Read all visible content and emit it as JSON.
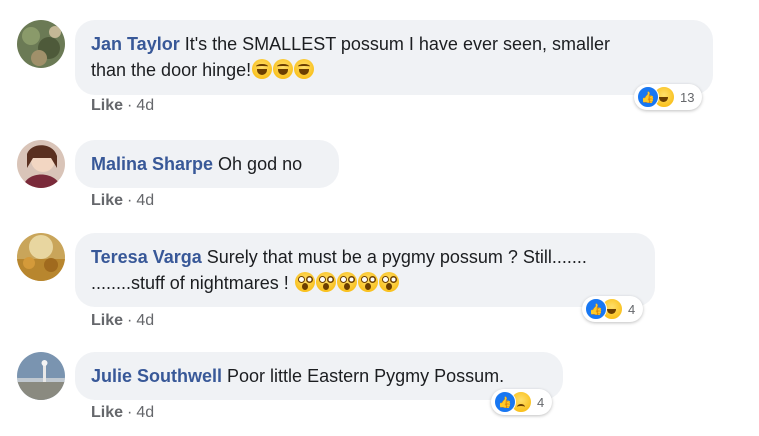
{
  "comments": [
    {
      "author": "Jan Taylor",
      "text": "It's the SMALLEST possum I have ever seen, smaller than the door hinge!",
      "text_line1": "It's the SMALLEST possum I have ever seen, smaller",
      "text_line2": "than the door hinge!",
      "like_label": "Like",
      "time": "4d",
      "reaction_count": "13",
      "reactions": [
        "like-icon",
        "haha-icon"
      ],
      "emojis": [
        "rolling-laughing-emoji",
        "rolling-laughing-emoji",
        "rolling-laughing-emoji"
      ]
    },
    {
      "author": "Malina Sharpe",
      "text": "Oh god no",
      "like_label": "Like",
      "time": "4d"
    },
    {
      "author": "Teresa Varga",
      "text_line1": "Surely that must be a pygmy possum ? Still.......",
      "text_line2": "........stuff of nightmares !",
      "like_label": "Like",
      "time": "4d",
      "reaction_count": "4",
      "reactions": [
        "like-icon",
        "haha-icon"
      ],
      "emojis": [
        "astonished-emoji",
        "astonished-emoji",
        "astonished-emoji",
        "astonished-emoji",
        "astonished-emoji"
      ]
    },
    {
      "author": "Julie Southwell",
      "text": "Poor little Eastern Pygmy Possum.",
      "like_label": "Like",
      "time": "4d",
      "reaction_count": "4",
      "reactions": [
        "like-icon",
        "sad-icon"
      ]
    }
  ],
  "colors": {
    "author": "#385898",
    "bubble": "#f0f2f5",
    "meta": "#65676b",
    "like_reaction": "#1877f2"
  }
}
